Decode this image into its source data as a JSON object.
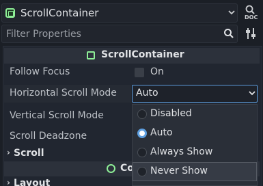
{
  "header": {
    "node_name": "ScrollContainer",
    "doc_label": "DOC"
  },
  "filter": {
    "placeholder": "Filter Properties"
  },
  "section": {
    "title": "ScrollContainer"
  },
  "properties": {
    "follow_focus_label": "Follow Focus",
    "follow_focus_value": "On",
    "horizontal_label": "Horizontal Scroll Mode",
    "horizontal_value": "Auto",
    "vertical_label": "Vertical Scroll Mode",
    "deadzone_label": "Scroll Deadzone"
  },
  "groups": {
    "scroll": "Scroll",
    "layout": "Layout"
  },
  "subsection": {
    "title": "Co"
  },
  "menu": {
    "items": [
      {
        "label": "Disabled",
        "checked": false
      },
      {
        "label": "Auto",
        "checked": true
      },
      {
        "label": "Always Show",
        "checked": false
      },
      {
        "label": "Never Show",
        "checked": false
      }
    ]
  },
  "colors": {
    "accent": "#5e9fe0",
    "node_icon": "#8eef97",
    "background": "#1b1f26"
  },
  "icons": {
    "node": "scroll-container-icon",
    "chevron": "chevron-down-icon",
    "doc": "doc-icon",
    "search": "search-icon",
    "tools": "tools-icon"
  }
}
